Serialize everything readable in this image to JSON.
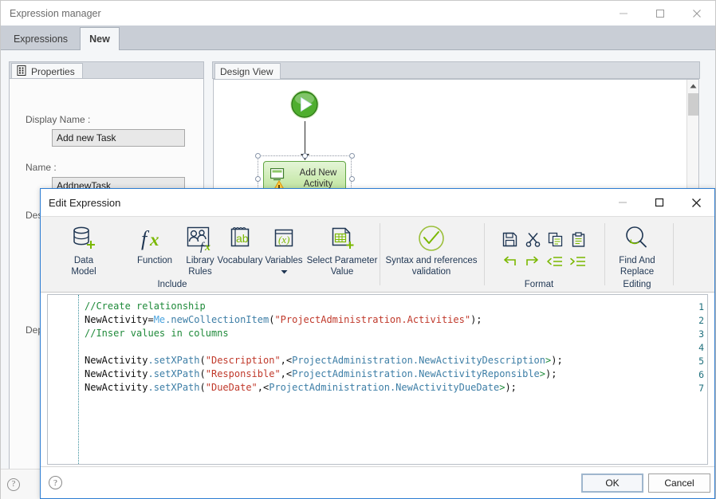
{
  "main_window": {
    "title": "Expression manager",
    "window_controls": [
      {
        "name": "minimize",
        "glyph": "minimize-icon"
      },
      {
        "name": "maximize",
        "glyph": "maximize-icon"
      },
      {
        "name": "close",
        "glyph": "close-icon"
      }
    ],
    "tabs": [
      {
        "label": "Expressions",
        "active": false
      },
      {
        "label": "New",
        "active": true
      }
    ],
    "properties_panel": {
      "tab_label": "Properties",
      "tab_icon": "properties-grid-icon",
      "fields": [
        {
          "label": "Display Name :",
          "value": "Add new Task"
        },
        {
          "label": "Name :",
          "value": "AddnewTask"
        },
        {
          "label": "Des",
          "value": ""
        },
        {
          "label": "Dep",
          "value": ""
        }
      ]
    },
    "design_panel": {
      "tab_label": "Design View",
      "start_node_name": "start-node",
      "activity": {
        "label_line1": "Add New",
        "label_line2": "Activity"
      }
    },
    "status_help": "?"
  },
  "dialog": {
    "title": "Edit Expression",
    "window_controls": [
      {
        "name": "minimize",
        "glyph": "minimize-icon"
      },
      {
        "name": "maximize",
        "glyph": "maximize-icon"
      },
      {
        "name": "close",
        "glyph": "close-icon"
      }
    ],
    "ribbon": {
      "include_group_label": "Include",
      "format_group_label": "Format",
      "editing_group_label": "Editing",
      "items": [
        {
          "icon": "data-model-icon",
          "line1": "Data",
          "line2": "Model"
        },
        {
          "icon": "function-fx-icon",
          "line1": "Function",
          "line2": ""
        },
        {
          "icon": "library-rules-icon",
          "line1": "Library",
          "line2": "Rules"
        },
        {
          "icon": "vocabulary-ab-icon",
          "line1": "Vocabulary",
          "line2": ""
        },
        {
          "icon": "variables-x-icon",
          "line1": "Variables",
          "line2": "",
          "has_dropdown": true
        },
        {
          "icon": "select-parameter-value-icon",
          "line1": "Select Parameter",
          "line2": "Value"
        },
        {
          "icon": "syntax-validation-check-icon",
          "line1": "Syntax and references",
          "line2": "validation"
        }
      ],
      "format_icons": [
        {
          "name": "save-icon"
        },
        {
          "name": "cut-icon"
        },
        {
          "name": "copy-icon"
        },
        {
          "name": "paste-icon"
        },
        {
          "name": "undo-icon"
        },
        {
          "name": "redo-icon"
        },
        {
          "name": "outdent-icon"
        },
        {
          "name": "indent-icon"
        }
      ],
      "editing_item": {
        "icon": "find-replace-icon",
        "line1": "Find And",
        "line2": "Replace"
      }
    },
    "editor": {
      "line_numbers": [
        "1",
        "2",
        "3",
        "4",
        "5",
        "6",
        "7"
      ],
      "lines": [
        {
          "num": "1",
          "tokens": [
            {
              "t": "//Create relationship",
              "c": "tok-com"
            }
          ]
        },
        {
          "num": "2",
          "tokens": [
            {
              "t": "NewActivity=",
              "c": "tok-plain"
            },
            {
              "t": "Me",
              "c": "tok-me"
            },
            {
              "t": ".newCollectionItem",
              "c": "tok-meth"
            },
            {
              "t": "(",
              "c": "tok-punct"
            },
            {
              "t": "\"ProjectAdministration.Activities\"",
              "c": "tok-str"
            },
            {
              "t": ");",
              "c": "tok-punct"
            }
          ]
        },
        {
          "num": "3",
          "tokens": [
            {
              "t": "//Inser values in columns",
              "c": "tok-com"
            }
          ]
        },
        {
          "num": "4",
          "tokens": [
            {
              "t": "",
              "c": "tok-plain"
            }
          ]
        },
        {
          "num": "5",
          "tokens": [
            {
              "t": "NewActivity",
              "c": "tok-plain"
            },
            {
              "t": ".setXPath",
              "c": "tok-meth"
            },
            {
              "t": "(",
              "c": "tok-punct"
            },
            {
              "t": "\"Description\"",
              "c": "tok-str"
            },
            {
              "t": ",<",
              "c": "tok-punct"
            },
            {
              "t": "ProjectAdministration.NewActivityDescription",
              "c": "tok-meth"
            },
            {
              "t": ">",
              "c": "tok-ang"
            },
            {
              "t": ");",
              "c": "tok-punct"
            }
          ]
        },
        {
          "num": "6",
          "tokens": [
            {
              "t": "NewActivity",
              "c": "tok-plain"
            },
            {
              "t": ".setXPath",
              "c": "tok-meth"
            },
            {
              "t": "(",
              "c": "tok-punct"
            },
            {
              "t": "\"Responsible\"",
              "c": "tok-str"
            },
            {
              "t": ",<",
              "c": "tok-punct"
            },
            {
              "t": "ProjectAdministration.NewActivityReponsible",
              "c": "tok-meth"
            },
            {
              "t": ">",
              "c": "tok-ang"
            },
            {
              "t": ");",
              "c": "tok-punct"
            }
          ]
        },
        {
          "num": "7",
          "tokens": [
            {
              "t": "NewActivity",
              "c": "tok-plain"
            },
            {
              "t": ".setXPath",
              "c": "tok-meth"
            },
            {
              "t": "(",
              "c": "tok-punct"
            },
            {
              "t": "\"DueDate\"",
              "c": "tok-str"
            },
            {
              "t": ",<",
              "c": "tok-punct"
            },
            {
              "t": "ProjectAdministration.NewActivityDueDate",
              "c": "tok-meth"
            },
            {
              "t": ">",
              "c": "tok-ang"
            },
            {
              "t": ");",
              "c": "tok-punct"
            }
          ]
        }
      ]
    },
    "footer": {
      "help": "?",
      "ok_label": "OK",
      "cancel_label": "Cancel"
    }
  },
  "colors": {
    "accent_blue": "#2d7dd2",
    "ribbon_navy": "#1f3653",
    "ribbon_green": "#7ab800",
    "comment_green": "#1f8a3a",
    "string_red": "#c0392b",
    "tab_strip": "#c9ced6",
    "activity_green": "#62a644"
  }
}
